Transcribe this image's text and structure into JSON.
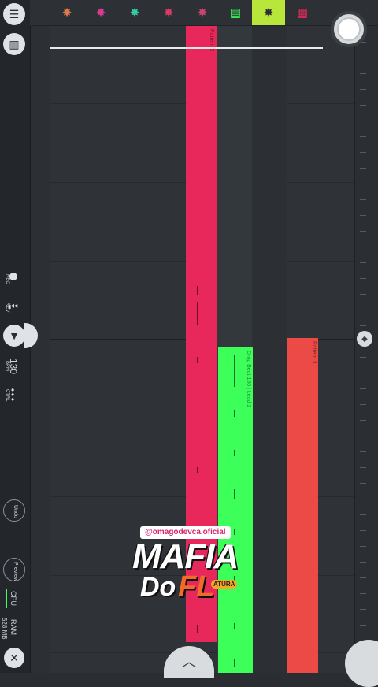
{
  "left_toolbar": {
    "mixer_icon": "mixer-icon",
    "channels_icon": "channel-rack-icon",
    "rec_label": "REC",
    "rev_label": "REV",
    "bpm_value": "130",
    "bpm_label": "BPM",
    "ctrl_label": "CTRL",
    "undo_label": "Undo",
    "preview_label": "Preview",
    "cpu_label": "CPU",
    "ram_label": "RAM",
    "ram_value": "528 MB",
    "close_icon": "close-icon"
  },
  "top_toolbar": {
    "tools": [
      {
        "name": "tool-orange",
        "glyph": "✸",
        "color": "#e0784a"
      },
      {
        "name": "tool-magenta",
        "glyph": "✸",
        "color": "#d93a8f"
      },
      {
        "name": "tool-teal",
        "glyph": "✸",
        "color": "#35c9a4"
      },
      {
        "name": "tool-pink",
        "glyph": "✸",
        "color": "#d93a6a"
      },
      {
        "name": "tool-rose",
        "glyph": "✸",
        "color": "#c8436e"
      }
    ],
    "piano_roll_icon": "piano-roll-icon",
    "active_tool_icon": "waveform-icon",
    "playlist_icon": "playlist-icon",
    "accent_active": "#b9e63a"
  },
  "playlist": {
    "clips": [
      {
        "name": "clip-red",
        "color": "#e8285a",
        "label": "Pattern 2"
      },
      {
        "name": "clip-green",
        "color": "#3dff5a",
        "label": "Drop Beat 130 | Lead 2"
      },
      {
        "name": "clip-coral",
        "color": "#ec4a46",
        "label": "Pattern 3"
      }
    ]
  },
  "watermark": {
    "handle": "@omagodevca.oficial",
    "title": "MAFIA",
    "subtitle_a": "Do",
    "subtitle_b": "FL",
    "badge": "ATURA"
  },
  "transport": {
    "play_icon": "record-play-icon",
    "scroll_up_icon": "chevron-up-icon"
  }
}
